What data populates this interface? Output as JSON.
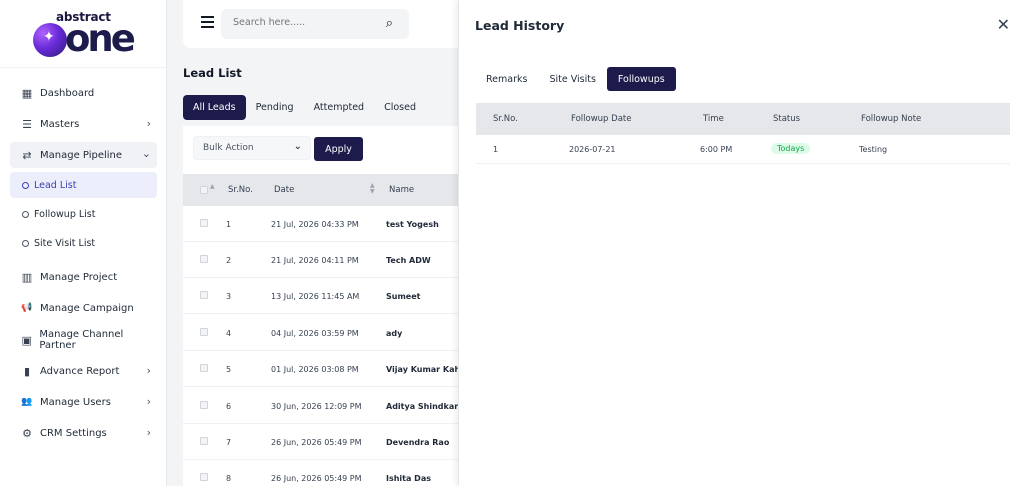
{
  "brand": {
    "top": "abstract",
    "main": "one"
  },
  "sidebar": {
    "items": [
      {
        "label": "Dashboard",
        "icon": "dashboard-icon",
        "glyph": "▦"
      },
      {
        "label": "Masters",
        "icon": "list-icon",
        "glyph": "☰",
        "chevron": "›"
      },
      {
        "label": "Manage Pipeline",
        "icon": "pipeline-icon",
        "glyph": "⇄",
        "chevron": "⌄"
      },
      {
        "label": "Manage Project",
        "icon": "building-icon",
        "glyph": "▥"
      },
      {
        "label": "Manage Campaign",
        "icon": "megaphone-icon",
        "glyph": "📢"
      },
      {
        "label": "Manage Channel Partner",
        "icon": "partner-icon",
        "glyph": "▣"
      },
      {
        "label": "Advance Report",
        "icon": "bar-chart-icon",
        "glyph": "▮",
        "chevron": "›"
      },
      {
        "label": "Manage Users",
        "icon": "users-icon",
        "glyph": "👥",
        "chevron": "›"
      },
      {
        "label": "CRM Settings",
        "icon": "gear-icon",
        "glyph": "⚙",
        "chevron": "›"
      }
    ],
    "subitems": [
      {
        "label": "Lead List"
      },
      {
        "label": "Followup List"
      },
      {
        "label": "Site Visit List"
      }
    ]
  },
  "search": {
    "placeholder": "Search here.....",
    "icon_glyph": "⌕"
  },
  "page": {
    "title": "Lead List"
  },
  "tabs": [
    "All Leads",
    "Pending",
    "Attempted",
    "Closed"
  ],
  "bulk": {
    "label": "Bulk Action",
    "chevron": "⌄",
    "apply": "Apply"
  },
  "table": {
    "headers": {
      "srno": "Sr.No.",
      "date": "Date",
      "name": "Name"
    },
    "rows": [
      {
        "sr": "1",
        "date": "21 Jul, 2026 04:33 PM",
        "name": "test Yogesh"
      },
      {
        "sr": "2",
        "date": "21 Jul, 2026 04:11 PM",
        "name": "Tech ADW"
      },
      {
        "sr": "3",
        "date": "13 Jul, 2026 11:45 AM",
        "name": "Sumeet"
      },
      {
        "sr": "4",
        "date": "04 Jul, 2026 03:59 PM",
        "name": "ady"
      },
      {
        "sr": "5",
        "date": "01 Jul, 2026 03:08 PM",
        "name": "Vijay Kumar Kahar"
      },
      {
        "sr": "6",
        "date": "30 Jun, 2026 12:09 PM",
        "name": "Aditya Shindkar"
      },
      {
        "sr": "7",
        "date": "26 Jun, 2026 05:49 PM",
        "name": "Devendra Rao"
      },
      {
        "sr": "8",
        "date": "26 Jun, 2026 05:49 PM",
        "name": "Ishita Das"
      }
    ]
  },
  "modal": {
    "title": "Lead History",
    "close_glyph": "✕",
    "tabs": [
      "Remarks",
      "Site Visits",
      "Followups"
    ],
    "headers": {
      "srno": "Sr.No.",
      "date": "Followup Date",
      "time": "Time",
      "status": "Status",
      "note": "Followup Note"
    },
    "rows": [
      {
        "sr": "1",
        "date": "2026-07-21",
        "time": "6:00 PM",
        "status": "Todays",
        "note": "Testing"
      }
    ]
  },
  "colors": {
    "primary": "#1d1b4b",
    "status_green_bg": "#dcfce7",
    "status_green_text": "#16a34a"
  }
}
